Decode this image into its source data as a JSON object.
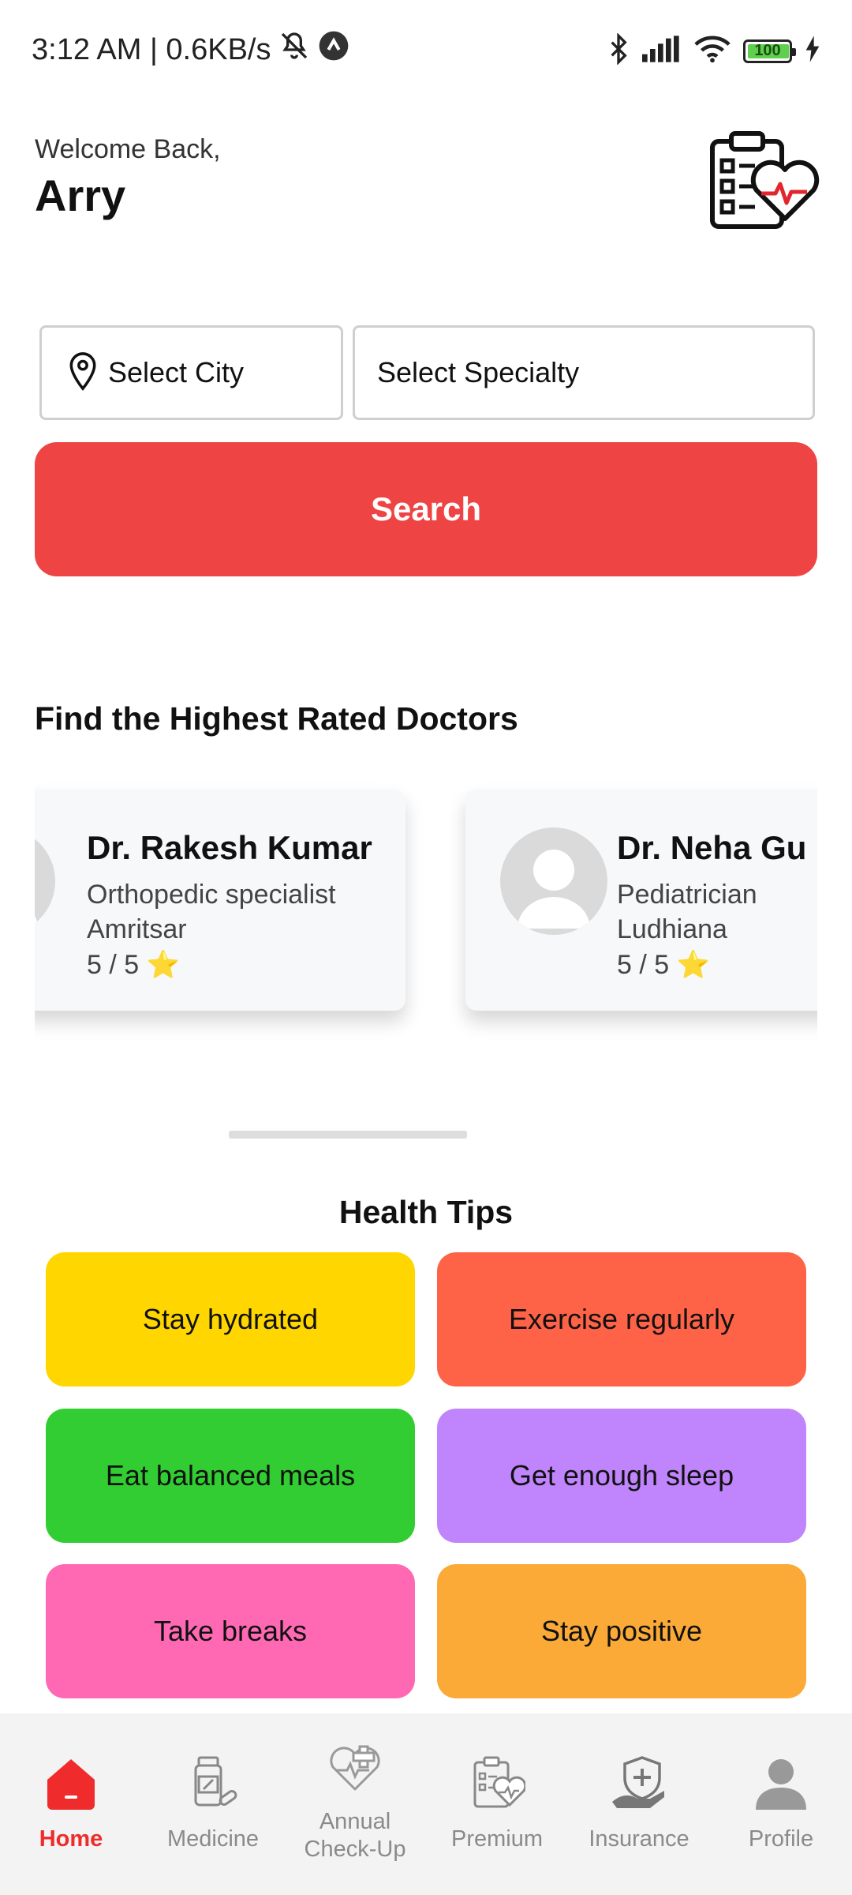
{
  "status_bar": {
    "time_speed": "3:12 AM | 0.6KB/s",
    "battery": "100"
  },
  "header": {
    "welcome": "Welcome Back,",
    "user_name": "Arry"
  },
  "search": {
    "city_label": "Select City",
    "specialty_label": "Select Specialty",
    "button_label": "Search"
  },
  "doctors": {
    "title": "Find the Highest Rated Doctors",
    "items": [
      {
        "name": "Dr. Rakesh Kumar",
        "specialty": "Orthopedic specialist",
        "city": "Amritsar",
        "rating": "5 / 5 ⭐"
      },
      {
        "name": "Dr. Neha Gu",
        "specialty": "Pediatrician",
        "city": "Ludhiana",
        "rating": "5 / 5 ⭐"
      }
    ]
  },
  "health_tips": {
    "title": "Health Tips",
    "items": [
      {
        "label": "Stay hydrated",
        "color": "#FFD600"
      },
      {
        "label": "Exercise regularly",
        "color": "#FF6347"
      },
      {
        "label": "Eat balanced meals",
        "color": "#32CD32"
      },
      {
        "label": "Get enough sleep",
        "color": "#C084FC"
      },
      {
        "label": "Take breaks",
        "color": "#FF69B4"
      },
      {
        "label": "Stay positive",
        "color": "#FBAA38"
      }
    ]
  },
  "nav": {
    "items": [
      {
        "label": "Home",
        "icon": "home-icon",
        "active": true
      },
      {
        "label": "Medicine",
        "icon": "medicine-icon"
      },
      {
        "label": "Annual\nCheck-Up",
        "icon": "heart-checkup-icon"
      },
      {
        "label": "Premium",
        "icon": "clipboard-heart-icon"
      },
      {
        "label": "Insurance",
        "icon": "insurance-shield-icon"
      },
      {
        "label": "Profile",
        "icon": "profile-icon"
      }
    ]
  },
  "colors": {
    "accent": "#EF4444",
    "active_nav": "#EF2B2B"
  }
}
